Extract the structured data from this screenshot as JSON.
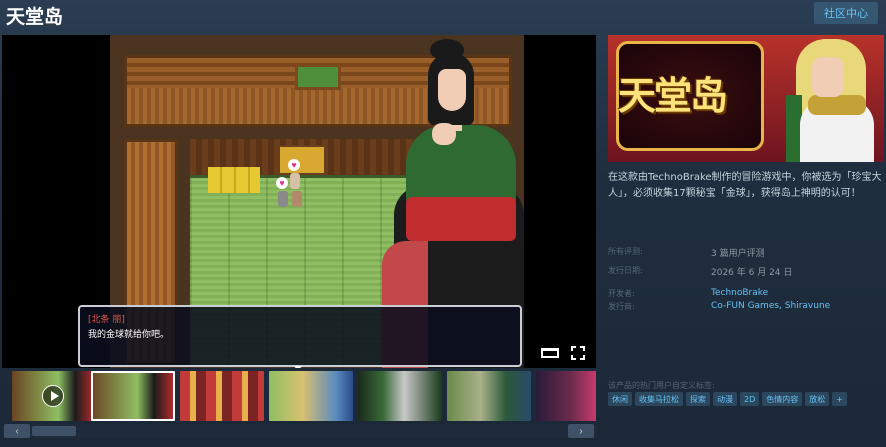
{
  "header": {
    "title": "天堂岛",
    "community_button": "社区中心"
  },
  "media": {
    "dialog_name": "[北条 丽]",
    "dialog_text": "我的金球就给你吧。",
    "thumbnail_count": 7
  },
  "capsule": {
    "title": "天堂岛"
  },
  "info": {
    "description": "在这款由TechnoBrake制作的冒险游戏中，你被选为「珍宝大人」，必须收集17颗秘宝「金球」，获得岛上神明的认可！",
    "reviews_label": "所有评测:",
    "reviews_value": "3 篇用户评测",
    "release_label": "发行日期:",
    "release_value": "2026 年 6 月 24 日",
    "developer_label": "开发者:",
    "developer_value": "TechnoBrake",
    "publisher_label": "发行商:",
    "publisher_value_1": "Co-FUN Games",
    "publisher_sep": ", ",
    "publisher_value_2": "Shiravune"
  },
  "tags": {
    "label": "该产品的热门用户自定义标签:",
    "items": [
      "休闲",
      "收集马拉松",
      "探索",
      "动漫",
      "2D",
      "色情内容",
      "放松",
      "+"
    ]
  },
  "scrollbar": {
    "left": "‹",
    "right": "›"
  }
}
